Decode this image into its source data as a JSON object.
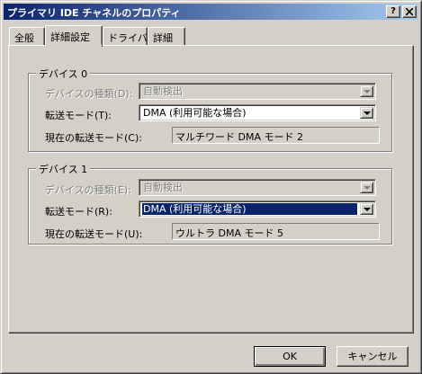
{
  "window": {
    "title": "プライマリ IDE チャネルのプロパティ"
  },
  "tabs": [
    {
      "label": "全般"
    },
    {
      "label": "詳細設定"
    },
    {
      "label": "ドライバ"
    },
    {
      "label": "詳細"
    }
  ],
  "device0": {
    "title": "デバイス 0",
    "type_label": "デバイスの種類(D):",
    "type_value": "自動検出",
    "mode_label": "転送モード(T):",
    "mode_value": "DMA (利用可能な場合)",
    "current_label": "現在の転送モード(C):",
    "current_value": "マルチワード DMA モード 2"
  },
  "device1": {
    "title": "デバイス 1",
    "type_label": "デバイスの種類(E):",
    "type_value": "自動検出",
    "mode_label": "転送モード(R):",
    "mode_value": "DMA (利用可能な場合)",
    "current_label": "現在の転送モード(U):",
    "current_value": "ウルトラ DMA モード 5"
  },
  "buttons": {
    "ok": "OK",
    "cancel": "キャンセル"
  },
  "icons": {
    "help": "?"
  }
}
